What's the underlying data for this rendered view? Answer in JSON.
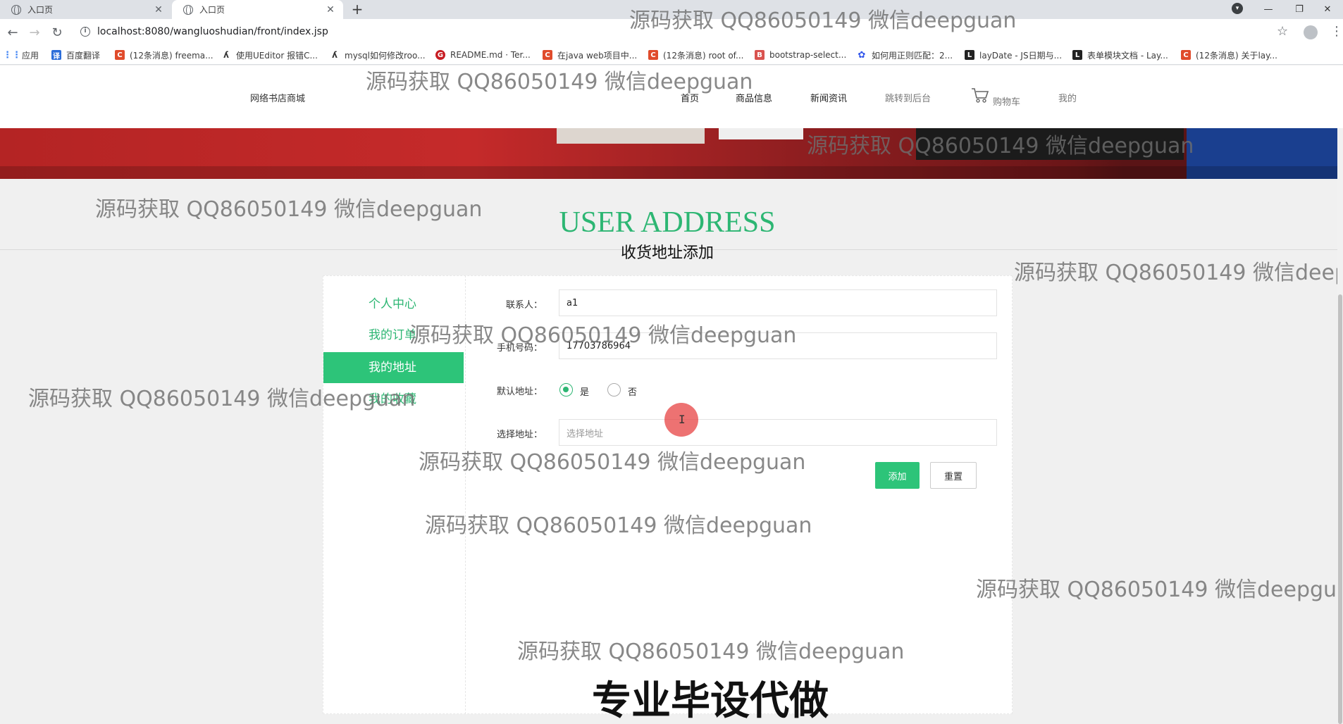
{
  "browser": {
    "tabs": [
      {
        "title": "入口页",
        "close": "✕"
      },
      {
        "title": "入口页",
        "close": "✕"
      }
    ],
    "new_tab": "+",
    "window_controls": [
      "—",
      "❐",
      "✕"
    ],
    "url": "localhost:8080/wangluoshudian/front/index.jsp",
    "bookmarks": [
      {
        "label": "应用",
        "color": "#e94235"
      },
      {
        "label": "百度翻译",
        "color": "#2b6dd9"
      },
      {
        "label": "(12条消息) freema...",
        "color": "#e04b2b"
      },
      {
        "label": "使用UEditor 报错C...",
        "color": "#333333"
      },
      {
        "label": "mysql如何修改roo...",
        "color": "#333333"
      },
      {
        "label": "README.md · Ter...",
        "color": "#c71d23"
      },
      {
        "label": "在java web项目中...",
        "color": "#e04b2b"
      },
      {
        "label": "(12条消息) root of...",
        "color": "#e04b2b"
      },
      {
        "label": "bootstrap-select...",
        "color": "#d9534f"
      },
      {
        "label": "如何用正则匹配：2...",
        "color": "#2f54eb"
      },
      {
        "label": "layDate - JS日期与...",
        "color": "#222222"
      },
      {
        "label": "表单模块文档 - Lay...",
        "color": "#222222"
      },
      {
        "label": "(12条消息) 关于lay...",
        "color": "#e04b2b"
      }
    ]
  },
  "site": {
    "logo": "网络书店商城",
    "nav": [
      "首页",
      "商品信息",
      "新闻资讯",
      "跳转到后台",
      "购物车",
      "我的"
    ]
  },
  "page": {
    "title_en": "USER ADDRESS",
    "title_cn": "收货地址添加"
  },
  "sidebar": {
    "items": [
      "个人中心",
      "我的订单",
      "我的地址",
      "我的收藏"
    ],
    "active_index": 2
  },
  "form": {
    "contact_label": "联系人：",
    "contact_value": "a1",
    "phone_label": "手机号码：",
    "phone_value": "17703786964",
    "default_label": "默认地址：",
    "default_yes": "是",
    "default_no": "否",
    "default_selected": "是",
    "address_label": "选择地址：",
    "address_placeholder": "选择地址",
    "add_button": "添加",
    "reset_button": "重置"
  },
  "cursor": "I",
  "watermark_text": "源码获取 QQ86050149 微信deepguan",
  "caption": "专业毕设代做",
  "colors": {
    "accent_green": "#2db673",
    "active_green": "#2dc479",
    "banner_red": "#c52a2a"
  }
}
